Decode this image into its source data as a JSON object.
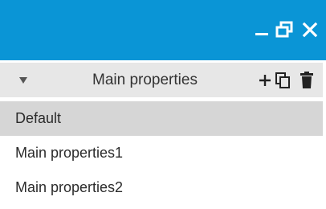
{
  "window": {
    "icons": {
      "minimize": "minimize-icon",
      "restore": "restore-icon",
      "close": "close-icon"
    },
    "colors": {
      "titlebar": "#0a95d6",
      "header": "#e7e7e7",
      "selected_row": "#d6d6d6"
    }
  },
  "header": {
    "label": "Main properties",
    "icons": {
      "collapse": "triangle-down-icon",
      "add": "plus-icon",
      "copy": "copy-icon",
      "delete": "trash-icon"
    }
  },
  "list": {
    "items": [
      {
        "label": "Default",
        "selected": true
      },
      {
        "label": "Main properties1",
        "selected": false
      },
      {
        "label": "Main properties2",
        "selected": false
      }
    ]
  }
}
